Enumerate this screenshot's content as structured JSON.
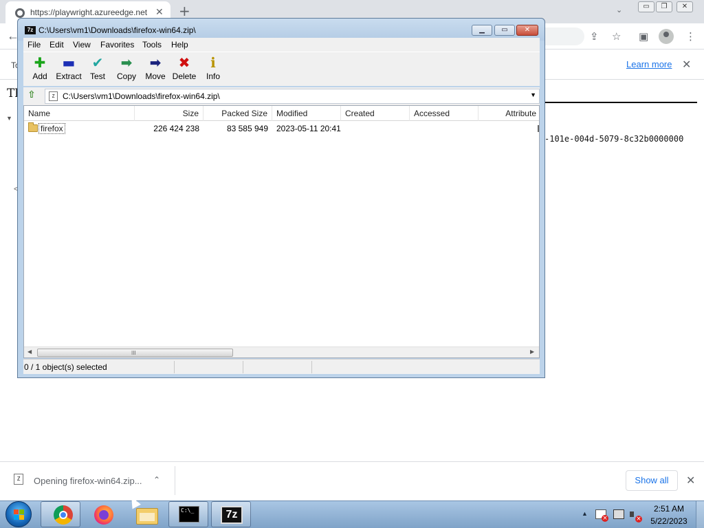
{
  "browser": {
    "tab_title": "https://playwright.azureedge.net",
    "tab_close": "✕",
    "new_tab": "+",
    "info_bar_text": "To",
    "learn_more": "Learn more",
    "page_heading": "Th",
    "page_mono_text": "-101e-004d-5079-8c32b0000000",
    "window_controls": [
      "▭",
      "❐",
      "✕"
    ]
  },
  "download_shelf": {
    "item_text": "Opening firefox-win64.zip...",
    "show_all": "Show all"
  },
  "sevenzip": {
    "title": "C:\\Users\\vm1\\Downloads\\firefox-win64.zip\\",
    "title_icon": "7z",
    "menu": [
      "File",
      "Edit",
      "View",
      "Favorites",
      "Tools",
      "Help"
    ],
    "toolbar": [
      {
        "label": "Add",
        "icon": "add-icon",
        "glyph": "✚",
        "color": "#1aa51a"
      },
      {
        "label": "Extract",
        "icon": "extract-icon",
        "glyph": "▬",
        "color": "#1c2fb5"
      },
      {
        "label": "Test",
        "icon": "test-icon",
        "glyph": "✔",
        "color": "#22a6a0"
      },
      {
        "label": "Copy",
        "icon": "copy-icon",
        "glyph": "➡",
        "color": "#2a8f4f"
      },
      {
        "label": "Move",
        "icon": "move-icon",
        "glyph": "➡",
        "color": "#1a237e"
      },
      {
        "label": "Delete",
        "icon": "delete-icon",
        "glyph": "✖",
        "color": "#d01010"
      },
      {
        "label": "Info",
        "icon": "info-icon",
        "glyph": "ℹ",
        "color": "#b89300"
      }
    ],
    "address": "C:\\Users\\vm1\\Downloads\\firefox-win64.zip\\",
    "columns": [
      "Name",
      "Size",
      "Packed Size",
      "Modified",
      "Created",
      "Accessed",
      "Attribute"
    ],
    "rows": [
      {
        "name": "firefox",
        "size": "226 424 238",
        "packed_size": "83 585 949",
        "modified": "2023-05-11 20:41",
        "created": "",
        "accessed": ""
      }
    ],
    "scroll_grip": "III",
    "status": "0 / 1 object(s) selected"
  },
  "taskbar": {
    "apps": [
      "chrome",
      "firefox",
      "explorer",
      "cmd",
      "7-zip"
    ],
    "cmd_label": "C:\\_",
    "sevenzip_label": "7z",
    "clock_time": "2:51 AM",
    "clock_date": "5/22/2023"
  }
}
